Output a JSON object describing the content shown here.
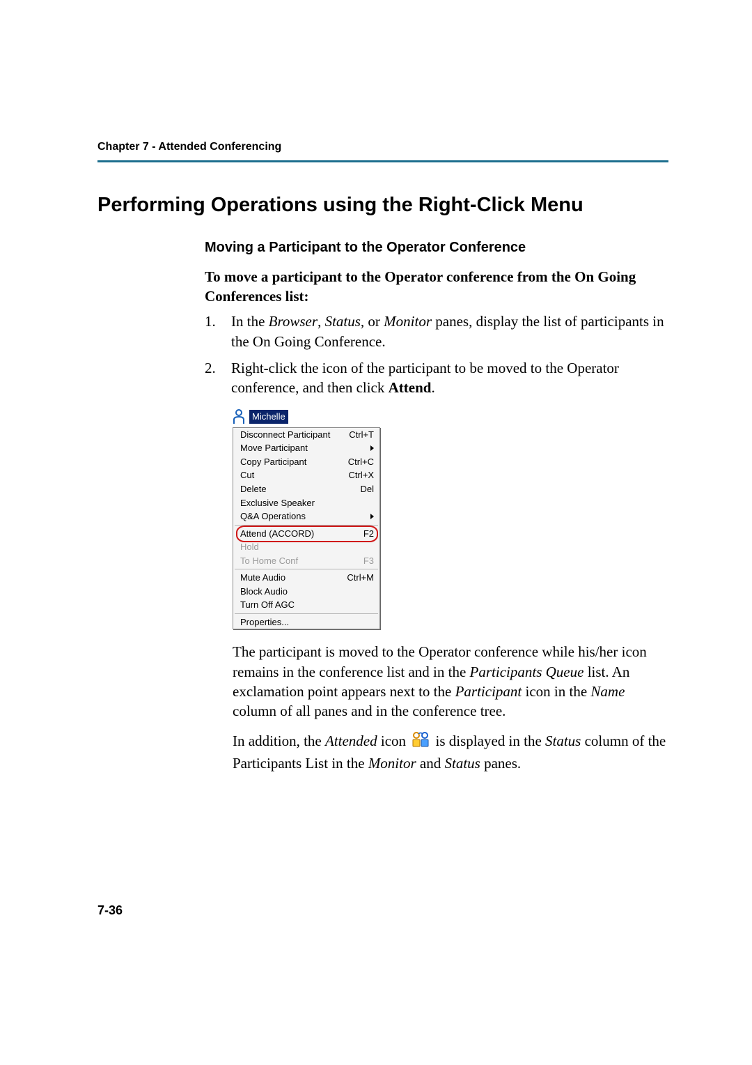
{
  "chapter_header": "Chapter 7 - Attended Conferencing",
  "section_title": "Performing Operations using the Right-Click Menu",
  "sub_title": "Moving a Participant to the Operator Conference",
  "lead_sentence": "To move a participant to the Operator conference from the On Going Conferences list:",
  "steps": [
    {
      "num": "1.",
      "pre": "In the ",
      "em1": "Browser",
      "mid1": ", ",
      "em2": "Status,",
      "mid2": " or ",
      "em3": "Monitor",
      "post": " panes, display the list of participants in the On Going Conference."
    },
    {
      "num": "2.",
      "pre": "Right-click the icon of the participant to be moved to the Operator conference, and then click ",
      "strong": "Attend",
      "post": "."
    }
  ],
  "context_menu": {
    "participant_name": "Michelle",
    "groups": [
      [
        {
          "label": "Disconnect Participant",
          "shortcut": "Ctrl+T",
          "sub": false,
          "enabled": true
        },
        {
          "label": "Move Participant",
          "shortcut": "",
          "sub": true,
          "enabled": true
        },
        {
          "label": "Copy Participant",
          "shortcut": "Ctrl+C",
          "sub": false,
          "enabled": true
        },
        {
          "label": "Cut",
          "shortcut": "Ctrl+X",
          "sub": false,
          "enabled": true
        },
        {
          "label": "Delete",
          "shortcut": "Del",
          "sub": false,
          "enabled": true
        },
        {
          "label": "Exclusive Speaker",
          "shortcut": "",
          "sub": false,
          "enabled": true
        },
        {
          "label": "Q&A Operations",
          "shortcut": "",
          "sub": true,
          "enabled": true
        }
      ],
      [
        {
          "label": "Attend (ACCORD)",
          "shortcut": "F2",
          "sub": false,
          "enabled": true,
          "highlight": true
        },
        {
          "label": "Hold",
          "shortcut": "",
          "sub": false,
          "enabled": false
        },
        {
          "label": "To Home Conf",
          "shortcut": "F3",
          "sub": false,
          "enabled": false
        }
      ],
      [
        {
          "label": "Mute Audio",
          "shortcut": "Ctrl+M",
          "sub": false,
          "enabled": true
        },
        {
          "label": "Block Audio",
          "shortcut": "",
          "sub": false,
          "enabled": true
        },
        {
          "label": "Turn Off AGC",
          "shortcut": "",
          "sub": false,
          "enabled": true
        }
      ],
      [
        {
          "label": "Properties...",
          "shortcut": "",
          "sub": false,
          "enabled": true
        }
      ]
    ]
  },
  "para1": {
    "pre": "The participant is moved to the Operator conference while his/her icon remains in the conference list and in the ",
    "em1": "Participants Queue",
    "mid1": " list. An exclamation point appears next to the ",
    "em2": "Participant",
    "mid2": " icon in the ",
    "em3": "Name",
    "post": " column of all panes and in the conference tree."
  },
  "para2": {
    "pre": "In addition, the ",
    "em1": "Attended",
    "mid1": " icon ",
    "mid2": " is displayed in the ",
    "em2": "Status",
    "mid3": " column of the Participants List in the ",
    "em3": "Monitor",
    "mid4": " and ",
    "em4": "Status",
    "post": " panes."
  },
  "page_number": "7-36"
}
